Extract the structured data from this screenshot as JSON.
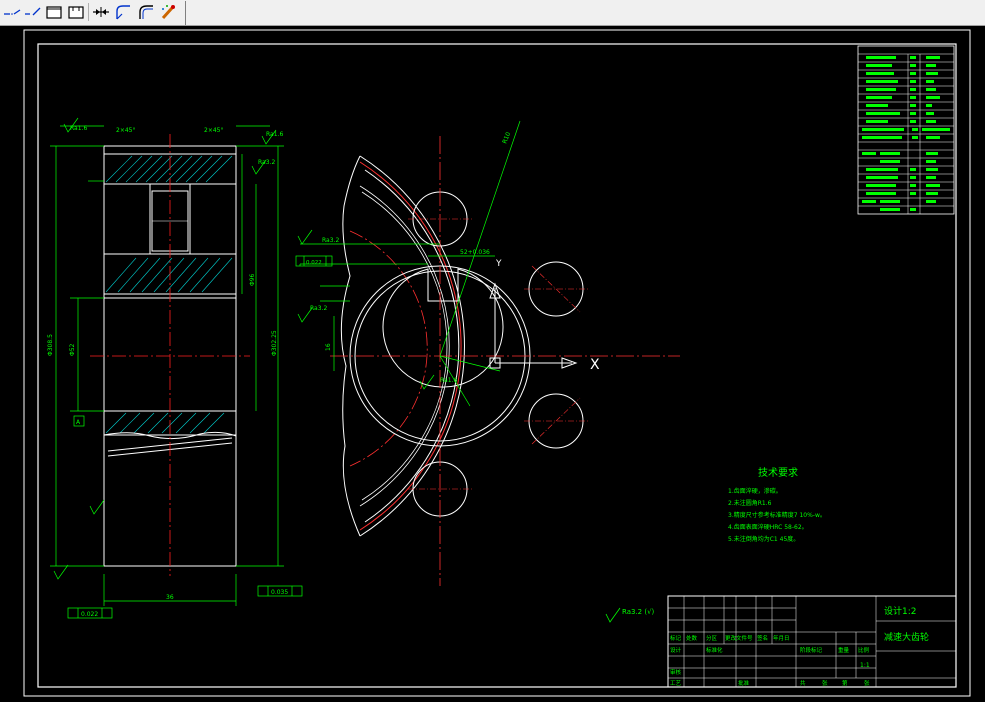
{
  "toolbar": {
    "buttons": [
      {
        "name": "line-dash-dot-icon"
      },
      {
        "name": "line-dash-icon"
      },
      {
        "name": "rectangle-icon"
      },
      {
        "name": "open-rectangle-icon"
      },
      {
        "name": "dimension-arrows-icon"
      },
      {
        "name": "curve-icon"
      },
      {
        "name": "fillet-icon"
      },
      {
        "name": "magic-pen-icon"
      }
    ]
  },
  "drawing": {
    "tech_req_title": "技术要求",
    "tech_req_items": [
      "1.齿面淬硬，渗碳。",
      "2.未注圆角R1.6",
      "3.精度尺寸参考标准精度7 10%-w。",
      "4.齿面表面淬硬HRC 58-62。",
      "5.未注倒角均为C1 45度。"
    ],
    "title_block": {
      "part_name": "减速大齿轮",
      "drawing_no": "设计1:2",
      "scale": "1:1",
      "labels": [
        "标记",
        "处数",
        "分区",
        "更改文件号",
        "签名",
        "年月日",
        "设计",
        "标准化",
        "阶段标记",
        "重量",
        "比例",
        "审核",
        "工艺",
        "批准",
        "共",
        "张",
        "第",
        "张"
      ]
    },
    "roughness_note": "Ra3.2 (√)",
    "dims": {
      "dim_width": "36",
      "dim_bore": "Φ52",
      "dim_outer": "Φ308.5",
      "dim_hub": "Φ96",
      "dim_tip": "Φ302.25",
      "tol_a": "0.022",
      "tol_b": "0.035",
      "key_dim": "16",
      "ra16": "Ra1.6",
      "ra32": "Ra3.2",
      "chamfer": "2×45°",
      "datum": "A",
      "radius_label": "R10",
      "phi_label": "Φ20",
      "hub_label": "D",
      "slot_dim": "52+0.036"
    }
  }
}
